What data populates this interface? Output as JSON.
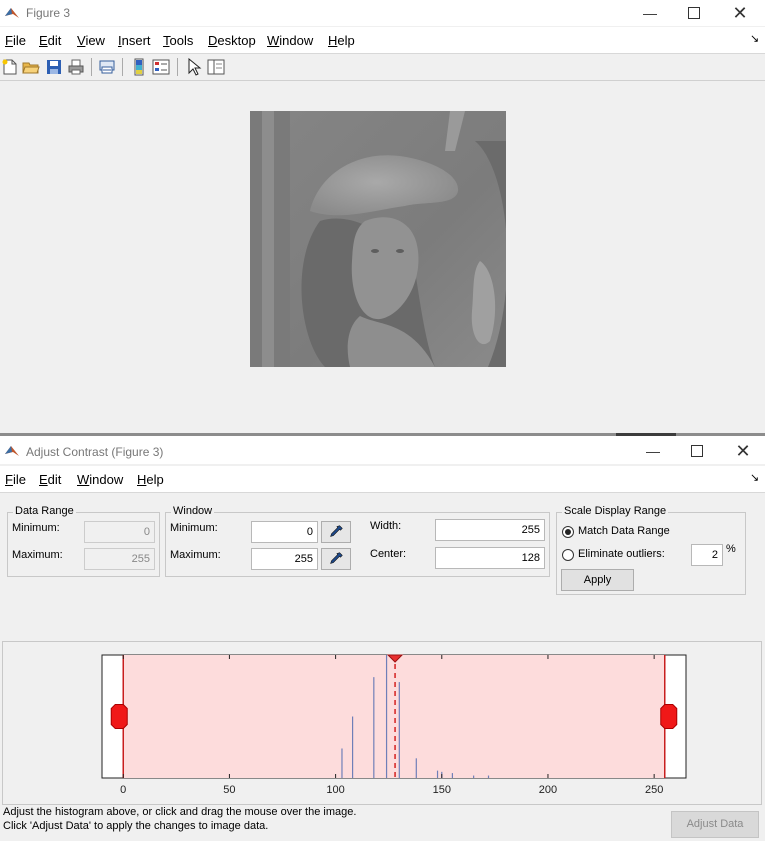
{
  "figure_window": {
    "title": "Figure 3",
    "menus": [
      "File",
      "Edit",
      "View",
      "Insert",
      "Tools",
      "Desktop",
      "Window",
      "Help"
    ],
    "menu_mnemonics": [
      "F",
      "E",
      "V",
      "I",
      "T",
      "D",
      "W",
      "H"
    ],
    "toolbar_icons": [
      "new-figure-icon",
      "open-file-icon",
      "save-icon",
      "print-icon",
      "print-preview-icon",
      "colorbar-icon",
      "legend-icon",
      "pointer-icon",
      "property-inspector-icon"
    ]
  },
  "contrast_window": {
    "title": "Adjust Contrast (Figure 3)",
    "menus": [
      "File",
      "Edit",
      "Window",
      "Help"
    ],
    "menu_mnemonics": [
      "F",
      "E",
      "W",
      "H"
    ],
    "data_range": {
      "legend": "Data Range",
      "min_label": "Minimum:",
      "min_value": "0",
      "max_label": "Maximum:",
      "max_value": "255"
    },
    "window_panel": {
      "legend": "Window",
      "min_label": "Minimum:",
      "min_value": "0",
      "max_label": "Maximum:",
      "max_value": "255",
      "width_label": "Width:",
      "width_value": "255",
      "center_label": "Center:",
      "center_value": "128"
    },
    "scale_panel": {
      "legend": "Scale Display Range",
      "match_label": "Match Data Range",
      "eliminate_label": "Eliminate outliers:",
      "outlier_value": "2",
      "percent": "%",
      "apply_label": "Apply",
      "selected": "match"
    },
    "instructions": [
      "Adjust the histogram above, or click and drag the mouse over the image.",
      "Click 'Adjust Data' to apply the changes to image data."
    ],
    "adjust_button": "Adjust Data"
  },
  "chart_data": {
    "type": "bar",
    "xlim": [
      -10,
      265
    ],
    "x_ticks": [
      0,
      50,
      100,
      150,
      200,
      250
    ],
    "x_tick_labels": [
      "0",
      "50",
      "100",
      "150",
      "200",
      "250"
    ],
    "window_min": 0,
    "window_max": 255,
    "center": 128,
    "x": [
      103,
      108,
      118,
      124,
      130,
      138,
      148,
      150,
      155,
      165,
      172
    ],
    "values": [
      0.24,
      0.5,
      0.82,
      1.0,
      0.78,
      0.16,
      0.06,
      0.05,
      0.04,
      0.02,
      0.02
    ],
    "colors": {
      "window_fill": "#fddcdc",
      "window_edge": "#c81e1e",
      "bars": "#6f7fb8",
      "center_line": "#d42020"
    }
  }
}
